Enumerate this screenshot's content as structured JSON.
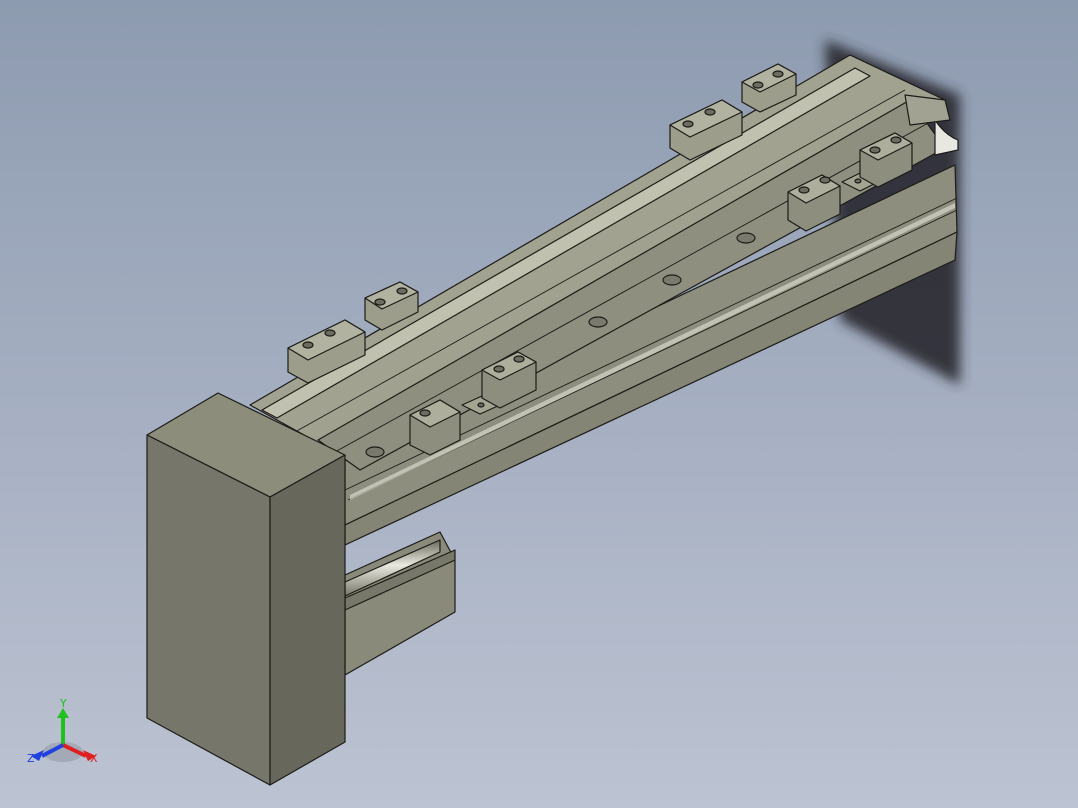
{
  "viewport": {
    "background_top": "#8d9bb0",
    "background_bottom": "#bcc3d2"
  },
  "model": {
    "part_color": "#9c9c8a",
    "dark_face": "#6f6f62",
    "light_face": "#b4b4a2",
    "shadow_color": "#2b2c30"
  },
  "triad": {
    "x_label": "X",
    "y_label": "Y",
    "z_label": "Z",
    "x_color": "#e02020",
    "y_color": "#20c020",
    "z_color": "#2040e0"
  }
}
